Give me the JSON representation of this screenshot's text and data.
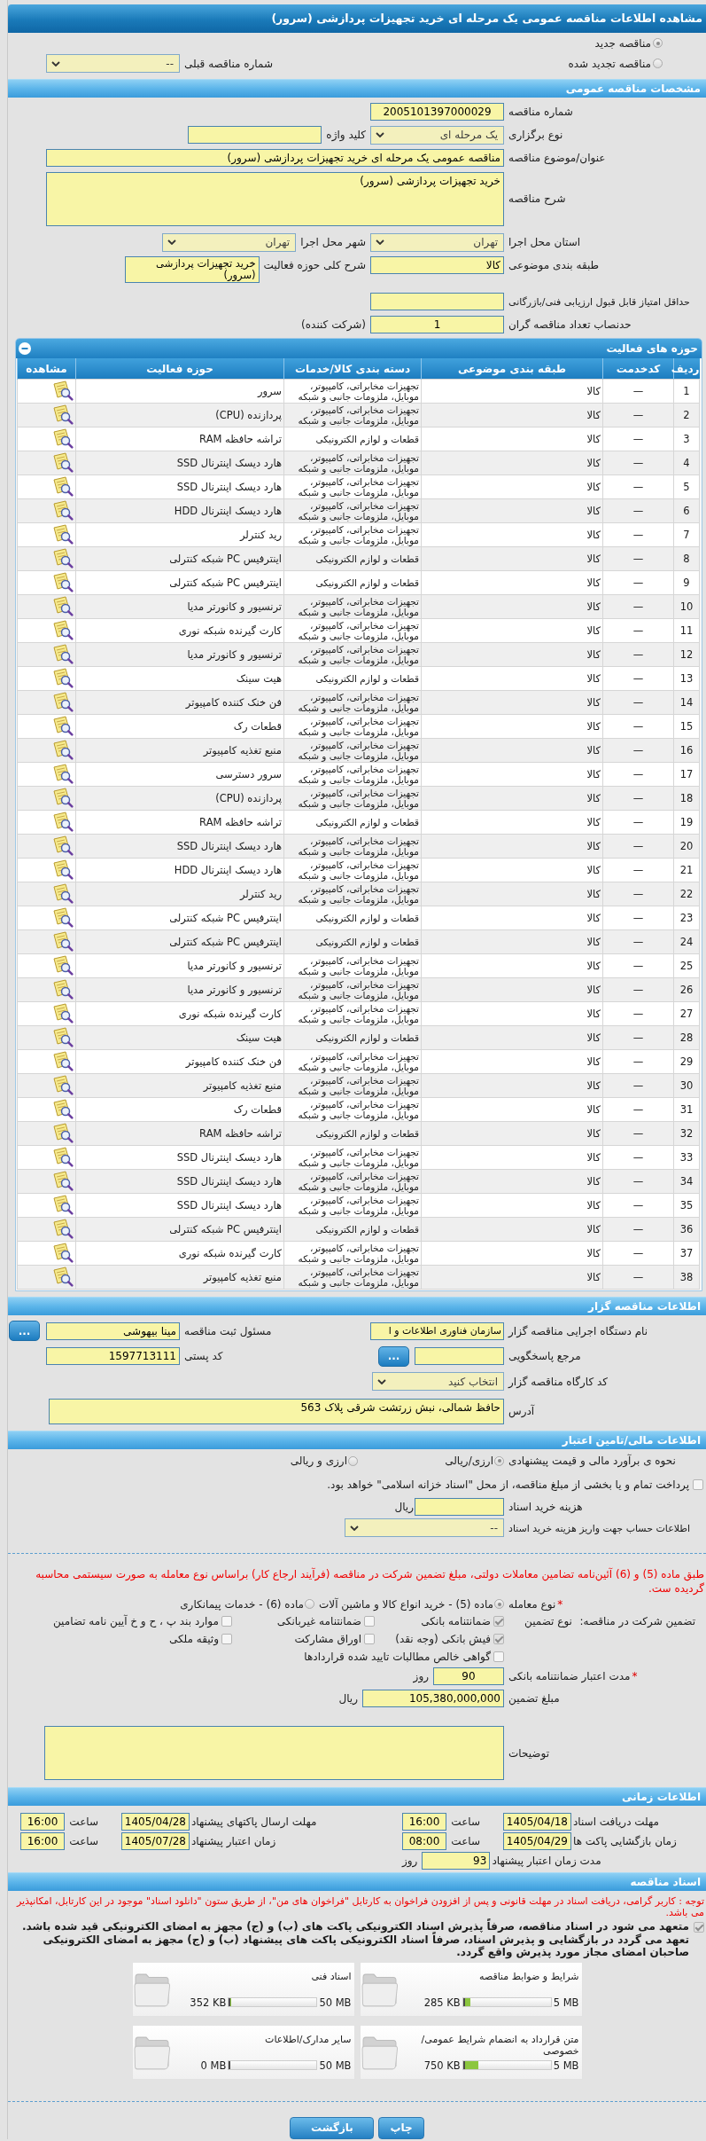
{
  "title": "مشاهده اطلاعات مناقصه عمومی یک مرحله ای خرید تجهیزات پردازشی (سرور)",
  "tender_status": {
    "options": [
      {
        "label": "مناقصه جدید",
        "selected": true
      },
      {
        "label": "مناقصه تجدید شده",
        "selected": false
      }
    ],
    "previous": {
      "label": "شماره مناقصه قبلی",
      "value": "--"
    }
  },
  "general": {
    "heading": "مشخصات مناقصه عمومی",
    "tender_number": {
      "label": "شماره مناقصه",
      "value": "2005101397000029"
    },
    "holding_type": {
      "label": "نوع برگزاری",
      "value": "یک مرحله ای"
    },
    "keyword": {
      "label": "کلید واژه"
    },
    "subject": {
      "label": "عنوان/موضوع مناقصه",
      "value": "مناقصه عمومی یک مرحله ای خرید تجهیزات پردازشی (سرور)"
    },
    "description": {
      "label": "شرح مناقصه",
      "value": "خرید تجهیزات پردازشی (سرور)"
    },
    "province": {
      "label": "استان محل اجرا",
      "value": "تهران"
    },
    "city": {
      "label": "شهر محل اجرا",
      "value": "تهران"
    },
    "category": {
      "label": "طبقه بندی موضوعی",
      "value": "کالا"
    },
    "activity_summary": {
      "label": "شرح کلی حوزه فعالیت",
      "value": "خرید تجهیزات پردازشی (سرور)"
    },
    "min_score": {
      "label": "حداقل امتیاز قابل قبول ارزیابی فنی/بازرگانی"
    },
    "min_bidders": {
      "label": "حدنصاب تعداد مناقصه گران",
      "value": "1",
      "unit": "(شرکت کننده)"
    }
  },
  "activities": {
    "heading": "حوزه های فعالیت",
    "expanded": true,
    "columns": [
      "ردیف",
      "کدخدمت",
      "طبقه بندی موضوعی",
      "دسته بندی کالا/خدمات",
      "حوزه فعالیت",
      "مشاهده"
    ],
    "rows": [
      {
        "number": "1",
        "code": "—",
        "classification": "کالا",
        "category": "تجهیزات مخابراتی، کامپیوتر، موبایل، ملزومات جانبی و شبکه",
        "activity": "سرور"
      },
      {
        "number": "2",
        "code": "—",
        "classification": "کالا",
        "category": "تجهیزات مخابراتی، کامپیوتر، موبایل، ملزومات جانبی و شبکه",
        "activity": "پردازنده (CPU)"
      },
      {
        "number": "3",
        "code": "—",
        "classification": "کالا",
        "category": "قطعات و لوازم الکترونیکی",
        "activity": "تراشه حافظه RAM"
      },
      {
        "number": "4",
        "code": "—",
        "classification": "کالا",
        "category": "تجهیزات مخابراتی، کامپیوتر، موبایل، ملزومات جانبی و شبکه",
        "activity": "هارد دیسک اینترنال SSD"
      },
      {
        "number": "5",
        "code": "—",
        "classification": "کالا",
        "category": "تجهیزات مخابراتی، کامپیوتر، موبایل، ملزومات جانبی و شبکه",
        "activity": "هارد دیسک اینترنال SSD"
      },
      {
        "number": "6",
        "code": "—",
        "classification": "کالا",
        "category": "تجهیزات مخابراتی، کامپیوتر، موبایل، ملزومات جانبی و شبکه",
        "activity": "هارد دیسک اینترنال HDD"
      },
      {
        "number": "7",
        "code": "—",
        "classification": "کالا",
        "category": "تجهیزات مخابراتی، کامپیوتر، موبایل، ملزومات جانبی و شبکه",
        "activity": "رید کنترلر"
      },
      {
        "number": "8",
        "code": "—",
        "classification": "کالا",
        "category": "قطعات و لوازم الکترونیکی",
        "activity": "اینترفیس PC شبکه کنترلی"
      },
      {
        "number": "9",
        "code": "—",
        "classification": "کالا",
        "category": "قطعات و لوازم الکترونیکی",
        "activity": "اینترفیس PC شبکه کنترلی"
      },
      {
        "number": "10",
        "code": "—",
        "classification": "کالا",
        "category": "تجهیزات مخابراتی، کامپیوتر، موبایل، ملزومات جانبی و شبکه",
        "activity": "ترنسیور و کانورتر مدیا"
      },
      {
        "number": "11",
        "code": "—",
        "classification": "کالا",
        "category": "تجهیزات مخابراتی، کامپیوتر، موبایل، ملزومات جانبی و شبکه",
        "activity": "کارت گیرنده شبکه نوری"
      },
      {
        "number": "12",
        "code": "—",
        "classification": "کالا",
        "category": "تجهیزات مخابراتی، کامپیوتر، موبایل، ملزومات جانبی و شبکه",
        "activity": "ترنسیور و کانورتر مدیا"
      },
      {
        "number": "13",
        "code": "—",
        "classification": "کالا",
        "category": "قطعات و لوازم الکترونیکی",
        "activity": "هیت سینک"
      },
      {
        "number": "14",
        "code": "—",
        "classification": "کالا",
        "category": "تجهیزات مخابراتی، کامپیوتر، موبایل، ملزومات جانبی و شبکه",
        "activity": "فن خنک کننده کامپیوتر"
      },
      {
        "number": "15",
        "code": "—",
        "classification": "کالا",
        "category": "تجهیزات مخابراتی، کامپیوتر، موبایل، ملزومات جانبی و شبکه",
        "activity": "قطعات رک"
      },
      {
        "number": "16",
        "code": "—",
        "classification": "کالا",
        "category": "تجهیزات مخابراتی، کامپیوتر، موبایل، ملزومات جانبی و شبکه",
        "activity": "منبع تغذیه کامپیوتر"
      },
      {
        "number": "17",
        "code": "—",
        "classification": "کالا",
        "category": "تجهیزات مخابراتی، کامپیوتر، موبایل، ملزومات جانبی و شبکه",
        "activity": "سرور دسترسی"
      },
      {
        "number": "18",
        "code": "—",
        "classification": "کالا",
        "category": "تجهیزات مخابراتی، کامپیوتر، موبایل، ملزومات جانبی و شبکه",
        "activity": "پردازنده (CPU)"
      },
      {
        "number": "19",
        "code": "—",
        "classification": "کالا",
        "category": "قطعات و لوازم الکترونیکی",
        "activity": "تراشه حافظه RAM"
      },
      {
        "number": "20",
        "code": "—",
        "classification": "کالا",
        "category": "تجهیزات مخابراتی، کامپیوتر، موبایل، ملزومات جانبی و شبکه",
        "activity": "هارد دیسک اینترنال SSD"
      },
      {
        "number": "21",
        "code": "—",
        "classification": "کالا",
        "category": "تجهیزات مخابراتی، کامپیوتر، موبایل، ملزومات جانبی و شبکه",
        "activity": "هارد دیسک اینترنال HDD"
      },
      {
        "number": "22",
        "code": "—",
        "classification": "کالا",
        "category": "تجهیزات مخابراتی، کامپیوتر، موبایل، ملزومات جانبی و شبکه",
        "activity": "رید کنترلر"
      },
      {
        "number": "23",
        "code": "—",
        "classification": "کالا",
        "category": "قطعات و لوازم الکترونیکی",
        "activity": "اینترفیس PC شبکه کنترلی"
      },
      {
        "number": "24",
        "code": "—",
        "classification": "کالا",
        "category": "قطعات و لوازم الکترونیکی",
        "activity": "اینترفیس PC شبکه کنترلی"
      },
      {
        "number": "25",
        "code": "—",
        "classification": "کالا",
        "category": "تجهیزات مخابراتی، کامپیوتر، موبایل، ملزومات جانبی و شبکه",
        "activity": "ترنسیور و کانورتر مدیا"
      },
      {
        "number": "26",
        "code": "—",
        "classification": "کالا",
        "category": "تجهیزات مخابراتی، کامپیوتر، موبایل، ملزومات جانبی و شبکه",
        "activity": "ترنسیور و کانورتر مدیا"
      },
      {
        "number": "27",
        "code": "—",
        "classification": "کالا",
        "category": "تجهیزات مخابراتی، کامپیوتر، موبایل، ملزومات جانبی و شبکه",
        "activity": "کارت گیرنده شبکه نوری"
      },
      {
        "number": "28",
        "code": "—",
        "classification": "کالا",
        "category": "قطعات و لوازم الکترونیکی",
        "activity": "هیت سینک"
      },
      {
        "number": "29",
        "code": "—",
        "classification": "کالا",
        "category": "تجهیزات مخابراتی، کامپیوتر، موبایل، ملزومات جانبی و شبکه",
        "activity": "فن خنک کننده کامپیوتر"
      },
      {
        "number": "30",
        "code": "—",
        "classification": "کالا",
        "category": "تجهیزات مخابراتی، کامپیوتر، موبایل، ملزومات جانبی و شبکه",
        "activity": "منبع تغذیه کامپیوتر"
      },
      {
        "number": "31",
        "code": "—",
        "classification": "کالا",
        "category": "تجهیزات مخابراتی، کامپیوتر، موبایل، ملزومات جانبی و شبکه",
        "activity": "قطعات رک"
      },
      {
        "number": "32",
        "code": "—",
        "classification": "کالا",
        "category": "قطعات و لوازم الکترونیکی",
        "activity": "تراشه حافظه RAM"
      },
      {
        "number": "33",
        "code": "—",
        "classification": "کالا",
        "category": "تجهیزات مخابراتی، کامپیوتر، موبایل، ملزومات جانبی و شبکه",
        "activity": "هارد دیسک اینترنال SSD"
      },
      {
        "number": "34",
        "code": "—",
        "classification": "کالا",
        "category": "تجهیزات مخابراتی، کامپیوتر، موبایل، ملزومات جانبی و شبکه",
        "activity": "هارد دیسک اینترنال SSD"
      },
      {
        "number": "35",
        "code": "—",
        "classification": "کالا",
        "category": "تجهیزات مخابراتی، کامپیوتر، موبایل، ملزومات جانبی و شبکه",
        "activity": "هارد دیسک اینترنال SSD"
      },
      {
        "number": "36",
        "code": "—",
        "classification": "کالا",
        "category": "قطعات و لوازم الکترونیکی",
        "activity": "اینترفیس PC شبکه کنترلی"
      },
      {
        "number": "37",
        "code": "—",
        "classification": "کالا",
        "category": "تجهیزات مخابراتی، کامپیوتر، موبایل، ملزومات جانبی و شبکه",
        "activity": "کارت گیرنده شبکه نوری"
      },
      {
        "number": "38",
        "code": "—",
        "classification": "کالا",
        "category": "تجهیزات مخابراتی، کامپیوتر، موبایل، ملزومات جانبی و شبکه",
        "activity": "منبع تغذیه کامپیوتر"
      }
    ]
  },
  "organizer": {
    "heading": "اطلاعات مناقصه گزار",
    "agency": {
      "label": "نام دستگاه اجرایی مناقصه گزار",
      "value": "سازمان فناوری اطلاعات و ا"
    },
    "registrar": {
      "label": "مسئول ثبت مناقصه",
      "value": "مینا بیهوشی",
      "button": "..."
    },
    "reference": {
      "label": "مرجع پاسخگویی",
      "button": "..."
    },
    "postal_code": {
      "label": "کد پستی",
      "value": "1597713111"
    },
    "workshop_code": {
      "label": "کد کارگاه مناقصه گزار",
      "value": "انتخاب کنید"
    },
    "address": {
      "label": "آدرس",
      "value": "حافظ شمالی، نبش زرتشت شرقی پلاک 563"
    }
  },
  "finance": {
    "heading": "اطلاعات مالی/تامین اعتبار",
    "estimate": {
      "label": "نحوه ی برآورد مالی و قیمت پیشنهادی",
      "options": [
        {
          "label": "ارزی/ریالی",
          "selected": true
        },
        {
          "label": "ارزی و ریالی",
          "selected": false
        }
      ]
    },
    "treasury": {
      "label": "پرداخت تمام و یا بخشی از مبلغ مناقصه، از محل \"اسناد خزانه اسلامی\" خواهد بود.",
      "checked": false
    },
    "doc_fee": {
      "label": "هزینه خرید اسناد",
      "unit": "ریال"
    },
    "account": {
      "label": "اطلاعات حساب جهت واریز هزینه خرید اسناد",
      "value": "--"
    }
  },
  "guarantee": {
    "notice": "طبق ماده (5) و (6) آئین‌نامه تضامین معاملات دولتی، مبلغ تضمین شرکت در مناقصه (فرآیند ارجاع کار) براساس نوع معامله به صورت سیستمی محاسبه گردیده ست.",
    "deal_type": {
      "mark": "*",
      "label": "نوع معامله",
      "options": [
        {
          "label": "ماده (5) - خرید انواع کالا و ماشین آلات",
          "selected": true
        },
        {
          "label": "ماده (6) - خدمات پیمانکاری",
          "selected": false
        }
      ]
    },
    "types": {
      "label": "تضمین شرکت در مناقصه:",
      "sublabel": "نوع تضمین",
      "options": [
        {
          "label": "ضمانتنامه بانکی",
          "checked": true
        },
        {
          "label": "ضمانتنامه غیربانکی",
          "checked": false
        },
        {
          "label": "موارد بند پ ، ح و خ آیین نامه تضامین",
          "checked": false
        },
        {
          "label": "فیش بانکی (وجه نقد)",
          "checked": true
        },
        {
          "label": "اوراق مشارکت",
          "checked": false
        },
        {
          "label": "وثیقه ملکی",
          "checked": false
        },
        {
          "label": "گواهی خالص مطالبات تایید شده قراردادها",
          "checked": false
        }
      ]
    },
    "validity": {
      "mark": "*",
      "label": "مدت اعتبار ضمانتنامه بانکی",
      "value": "90",
      "unit": "روز"
    },
    "amount": {
      "label": "مبلغ تضمین",
      "value": "105,380,000,000",
      "unit": "ریال"
    },
    "notes": {
      "label": "توضیحات"
    }
  },
  "timing": {
    "heading": "اطلاعات زمانی",
    "deadlines": [
      {
        "label": "مهلت دریافت اسناد",
        "date": "1405/04/18",
        "time_label": "ساعت",
        "time": "16:00"
      },
      {
        "label": "مهلت ارسال پاکتهای پیشنهاد",
        "date": "1405/04/28",
        "time_label": "ساعت",
        "time": "16:00"
      },
      {
        "label": "زمان بازگشایی پاکت ها",
        "date": "1405/04/29",
        "time_label": "ساعت",
        "time": "08:00"
      },
      {
        "label": "زمان اعتبار پیشنهاد",
        "date": "1405/07/28",
        "time_label": "ساعت",
        "time": "16:00"
      }
    ],
    "validity_period": {
      "label": "مدت زمان اعتبار پیشنهاد",
      "value": "93",
      "unit": "روز"
    }
  },
  "documents": {
    "heading": "اسناد مناقصه",
    "notice": "توجه : کاربر گرامی، دریافت اسناد در مهلت قانونی و پس از افزودن فراخوان به کارتابل \"فراخوان های من\"، از طریق ستون \"دانلود اسناد\" موجود در این کارتابل، امکانپذیر می باشد.",
    "commitment": {
      "text": "متعهد می شود در اسناد مناقصه، صرفاً پذیرش اسناد الکترونیکی پاکت های (ب) و (ج) مجهز به امضای الکترونیکی قید شده باشد. تعهد می گردد در بازگشایی و پذیرش اسناد، صرفاً اسناد الکترونیکی پاکت های پیشنهاد (ب) و (ج) مجهز به امضای الکترونیکی صاحبان امضای مجاز مورد پذیرش واقع گردد.",
      "checked": true
    },
    "files": [
      {
        "title": "شرایط و ضوابط مناقصه",
        "max": "5 MB",
        "size": "285 KB",
        "level": 0.06
      },
      {
        "title": "اسناد فنی",
        "max": "50 MB",
        "size": "352 KB",
        "level": 0.01
      },
      {
        "title": "متن قرارداد به انضمام شرایط عمومی/خصوصی",
        "max": "5 MB",
        "size": "750 KB",
        "level": 0.15
      },
      {
        "title": "سایر مدارک/اطلاعات",
        "max": "50 MB",
        "size": "0 MB",
        "level": 0
      }
    ]
  },
  "buttons": [
    {
      "label": "چاپ"
    },
    {
      "label": "بازگشت"
    }
  ]
}
